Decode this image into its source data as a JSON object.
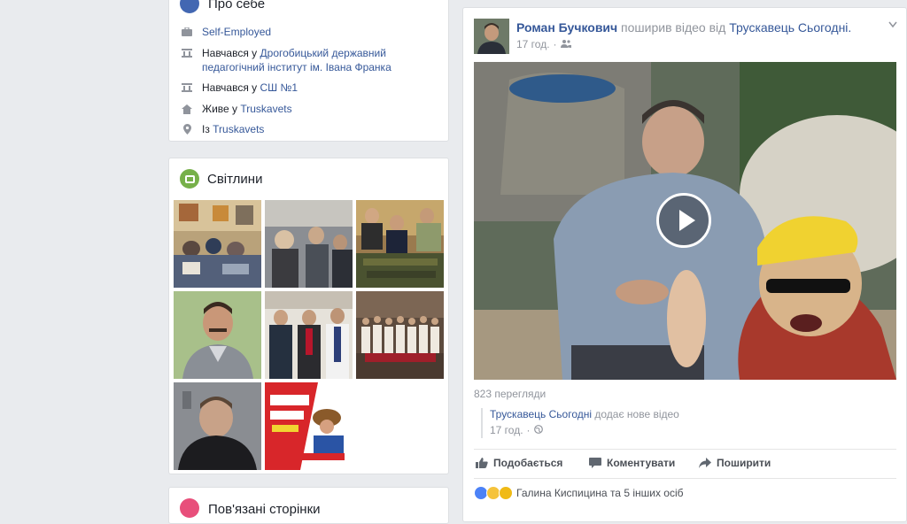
{
  "about": {
    "title": "Про себе",
    "rows": [
      {
        "icon": "briefcase-icon",
        "prefix": "",
        "link": "Self-Employed"
      },
      {
        "icon": "education-icon",
        "prefix": "Навчався у ",
        "link": "Дрогобицький державний педагогічний інститут ім. Івана Франка"
      },
      {
        "icon": "education-icon",
        "prefix": "Навчався у ",
        "link": "СШ №1"
      },
      {
        "icon": "home-icon",
        "prefix": "Живе у ",
        "link": "Truskavets"
      },
      {
        "icon": "location-pin-icon",
        "prefix": "Із ",
        "link": "Truskavets"
      }
    ]
  },
  "photos": {
    "title": "Світлини"
  },
  "third_card": {
    "title": "Пов'язані сторінки"
  },
  "post": {
    "author": "Роман Бучкович",
    "action": " поширив відео від ",
    "source": "Трускавець Сьогодні.",
    "time": "17 год.",
    "views": "823 перегляди",
    "shared_source": "Трускавець Сьогодні",
    "shared_action": " додає нове відео",
    "shared_time": "17 год.",
    "like_label": "Подобається",
    "comment_label": "Коментувати",
    "share_label": "Поширити",
    "reactions_text": "Галина Киспицина та 5 інших осіб"
  },
  "colors": {
    "link": "#365899",
    "brand": "#4267b2",
    "bg": "#e9ebee"
  }
}
